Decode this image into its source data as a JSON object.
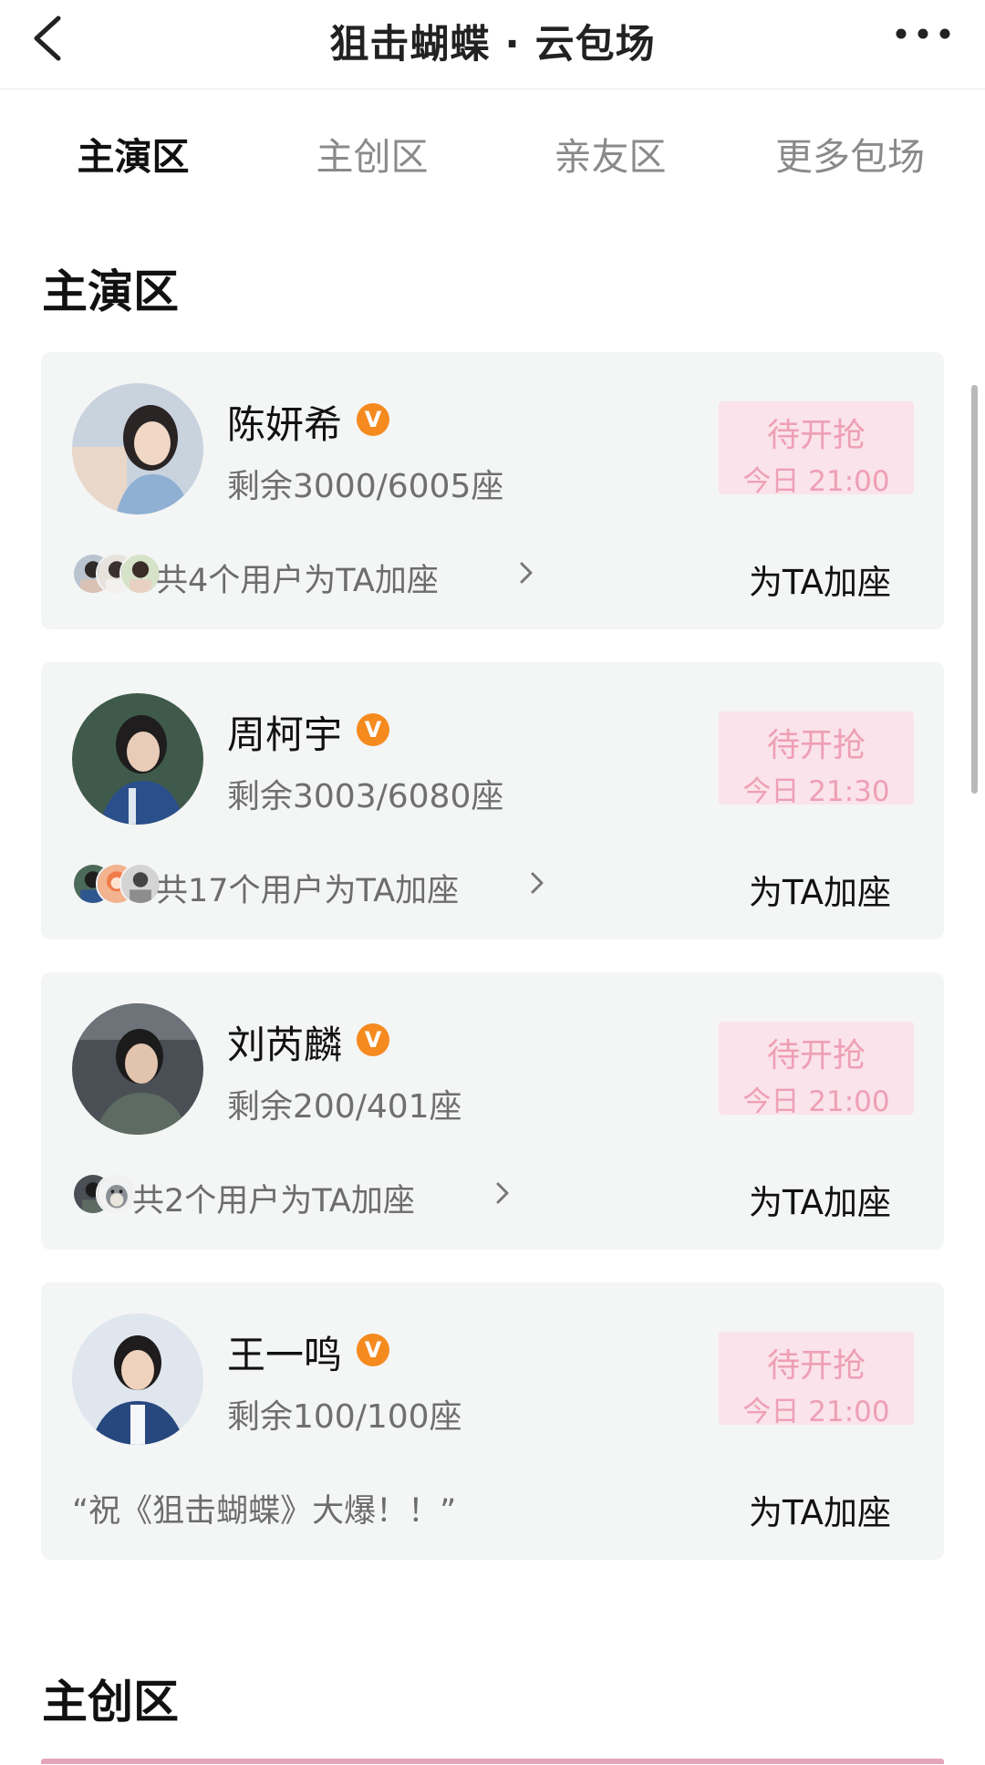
{
  "header": {
    "title": "狙击蝴蝶 · 云包场",
    "back_icon": "chevron-left-icon",
    "more_icon": "more-dots-icon"
  },
  "tabs": [
    {
      "label": "主演区",
      "active": true
    },
    {
      "label": "主创区",
      "active": false
    },
    {
      "label": "亲友区",
      "active": false
    },
    {
      "label": "更多包场",
      "active": false
    }
  ],
  "sections": {
    "main_cast_title": "主演区",
    "creators_title": "主创区"
  },
  "cards": [
    {
      "name": "陈妍希",
      "badge": "V",
      "seats": "剩余3000/6005座",
      "status": "待开抢",
      "time": "今日 21:00",
      "supporters_text": "共4个用户为TA加座",
      "action": "为TA加座"
    },
    {
      "name": "周柯宇",
      "badge": "V",
      "seats": "剩余3003/6080座",
      "status": "待开抢",
      "time": "今日 21:30",
      "supporters_text": "共17个用户为TA加座",
      "action": "为TA加座"
    },
    {
      "name": "刘芮麟",
      "badge": "V",
      "seats": "剩余200/401座",
      "status": "待开抢",
      "time": "今日 21:00",
      "supporters_text": "共2个用户为TA加座",
      "action": "为TA加座"
    },
    {
      "name": "王一鸣",
      "badge": "V",
      "seats": "剩余100/100座",
      "status": "待开抢",
      "time": "今日 21:00",
      "quote": "“祝《狙击蝴蝶》大爆！！”",
      "action": "为TA加座"
    }
  ],
  "colors": {
    "verified_badge": "#f58a1f",
    "status_bg": "#fae3ea",
    "status_text": "#ee9fb6",
    "card_bg": "#f4f5f5"
  }
}
